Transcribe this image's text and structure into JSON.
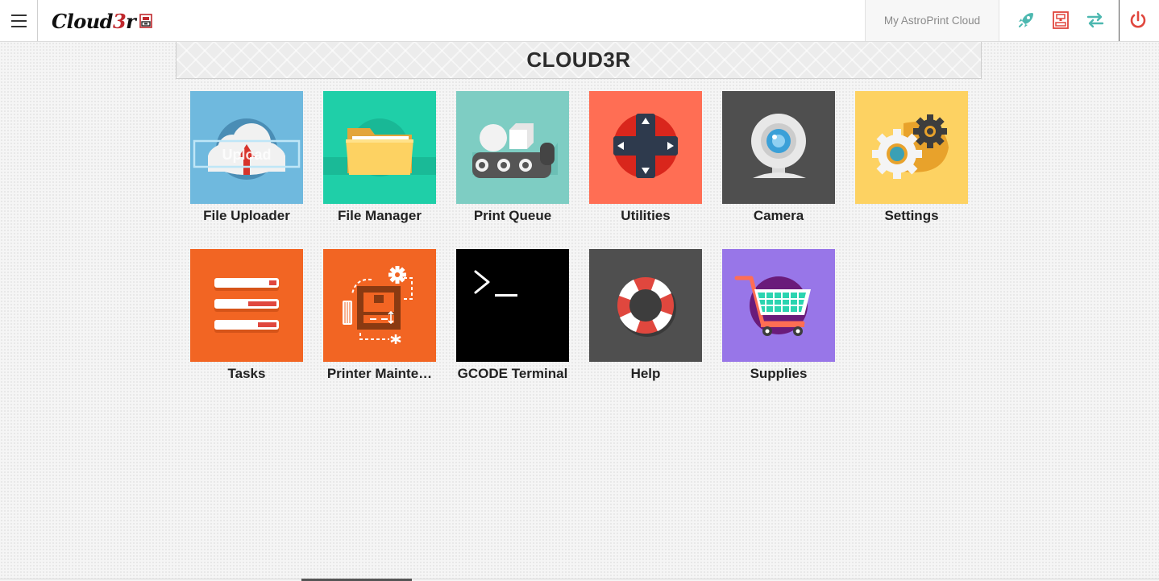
{
  "brand": {
    "logo_text_pre": "Cloud",
    "logo_text_accent": "3",
    "logo_text_post": "r"
  },
  "topbar": {
    "cloud_link": "My AstroPrint Cloud",
    "icons": [
      "rocket-icon",
      "printer-icon",
      "transfer-arrows-icon",
      "power-icon"
    ]
  },
  "banner": {
    "title": "CLOUD3R"
  },
  "apps": [
    {
      "label": "File Uploader",
      "tile_color": "#6fb9de",
      "icon_text": "Upload"
    },
    {
      "label": "File Manager",
      "tile_color": "#1fcfa8"
    },
    {
      "label": "Print Queue",
      "tile_color": "#7ecdc3"
    },
    {
      "label": "Utilities",
      "tile_color": "#ff6e54"
    },
    {
      "label": "Camera",
      "tile_color": "#4f4f4f"
    },
    {
      "label": "Settings",
      "tile_color": "#fdd262"
    },
    {
      "label": "Tasks",
      "tile_color": "#f26523"
    },
    {
      "label": "Printer Mainte…",
      "tile_color": "#f26523"
    },
    {
      "label": "GCODE Terminal",
      "tile_color": "#000000",
      "icon_text": ">_"
    },
    {
      "label": "Help",
      "tile_color": "#4f4f4f"
    },
    {
      "label": "Supplies",
      "tile_color": "#9876e8"
    }
  ],
  "colors": {
    "accent_red": "#c0282d",
    "icon_teal": "#4db8b0",
    "icon_red": "#e0473e",
    "title_text": "#2c2c2c"
  }
}
